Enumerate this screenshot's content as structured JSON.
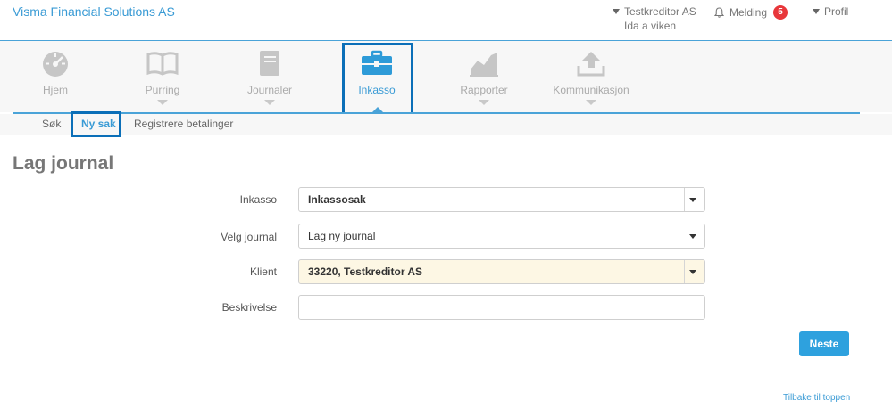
{
  "header": {
    "brand": "Visma Financial Solutions AS",
    "creditor": "Testkreditor AS",
    "creditor_sub": "Ida a viken",
    "melding_label": "Melding",
    "melding_count": "5",
    "profil_label": "Profil"
  },
  "nav": {
    "items": [
      {
        "label": "Hjem",
        "icon": "speedometer-icon"
      },
      {
        "label": "Purring",
        "icon": "book-icon"
      },
      {
        "label": "Journaler",
        "icon": "notebook-icon"
      },
      {
        "label": "Inkasso",
        "icon": "briefcase-icon"
      },
      {
        "label": "Rapporter",
        "icon": "chart-icon"
      },
      {
        "label": "Kommunikasjon",
        "icon": "upload-icon"
      }
    ],
    "active_color": "#3a9bd5"
  },
  "subnav": {
    "items": [
      "Søk",
      "Ny sak",
      "Registrere betalinger"
    ]
  },
  "page": {
    "title": "Lag journal"
  },
  "form": {
    "inkasso_label": "Inkasso",
    "inkasso_value": "Inkassosak",
    "journal_label": "Velg journal",
    "journal_value": "Lag ny journal",
    "klient_label": "Klient",
    "klient_value": "33220, Testkreditor AS",
    "beskrivelse_label": "Beskrivelse",
    "beskrivelse_value": ""
  },
  "actions": {
    "next_label": "Neste",
    "back_to_top": "Tilbake til toppen"
  },
  "colors": {
    "accent": "#2ea1de",
    "highlight_box": "#0b6fb8",
    "badge": "#e8373b"
  }
}
